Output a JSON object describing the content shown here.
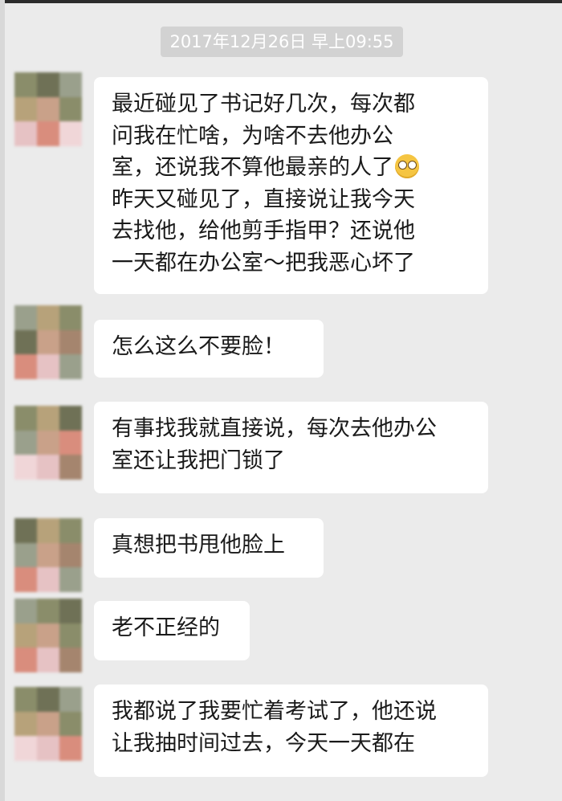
{
  "timestamp": "2017年12月26日 早上09:55",
  "messages": [
    {
      "lines": [
        "最近碰见了书记好几次，每次都",
        "问我在忙啥，为啥不去他办公",
        "室，还说我不算他最亲的人了",
        "昨天又碰见了，直接说让我今天",
        "去找他，给他剪手指甲？还说他",
        "一天都在办公室～把我恶心坏了"
      ],
      "emoji": "eye-roll-emoji"
    },
    {
      "lines": [
        "怎么这么不要脸！"
      ]
    },
    {
      "lines": [
        "有事找我就直接说，每次去他办公",
        "室还让我把门锁了"
      ]
    },
    {
      "lines": [
        "真想把书甩他脸上"
      ]
    },
    {
      "lines": [
        "老不正经的"
      ]
    },
    {
      "lines": [
        "我都说了我要忙着考试了，他还说",
        "让我抽时间过去，今天一天都在"
      ]
    }
  ],
  "colors": {
    "background": "#ebebeb",
    "bubble": "#ffffff",
    "timestamp_pill": "#d2d2d2",
    "avatar_palette": [
      "#8a8d6a",
      "#b7a27a",
      "#6f7156",
      "#c9a189",
      "#d98d7d",
      "#a5856e",
      "#e6c2c4",
      "#f0d6d8",
      "#9aa08c"
    ]
  }
}
